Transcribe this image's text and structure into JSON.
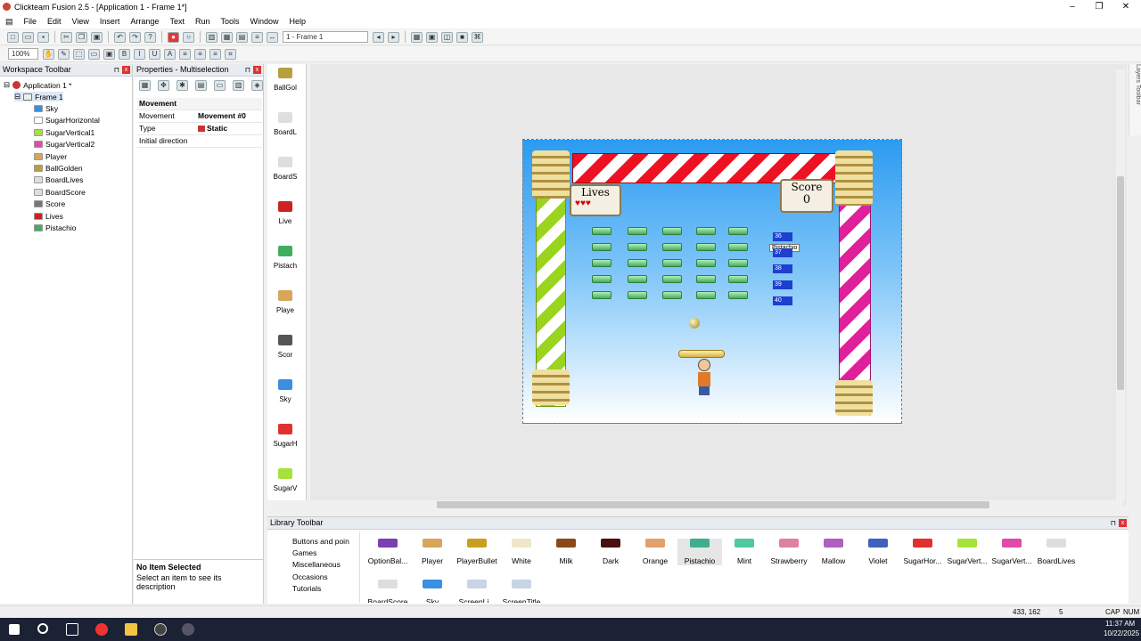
{
  "window": {
    "title": "Clickteam Fusion 2.5 - [Application 1 - Frame 1*]"
  },
  "menu": [
    "File",
    "Edit",
    "View",
    "Insert",
    "Arrange",
    "Text",
    "Run",
    "Tools",
    "Window",
    "Help"
  ],
  "toolbar": {
    "frame_combo": "1 - Frame 1",
    "zoom": "100%"
  },
  "workspace": {
    "title": "Workspace Toolbar",
    "app": "Application 1 *",
    "frame": "Frame 1",
    "objects": [
      {
        "label": "Sky",
        "icon": "sky-icon",
        "color": "#3b8fe0"
      },
      {
        "label": "SugarHorizontal",
        "icon": "sugar-horizontal-icon",
        "color": "#ffffff"
      },
      {
        "label": "SugarVertical1",
        "icon": "sugar-vertical1-icon",
        "color": "#a6e23a"
      },
      {
        "label": "SugarVertical2",
        "icon": "sugar-vertical2-icon",
        "color": "#e04aa8"
      },
      {
        "label": "Player",
        "icon": "player-icon",
        "color": "#d9a55a"
      },
      {
        "label": "BallGolden",
        "icon": "ball-golden-icon",
        "color": "#b8a040"
      },
      {
        "label": "BoardLives",
        "icon": "board-lives-icon",
        "color": "#dedede"
      },
      {
        "label": "BoardScore",
        "icon": "board-score-icon",
        "color": "#dedede"
      },
      {
        "label": "Score",
        "icon": "score-icon",
        "color": "#777777"
      },
      {
        "label": "Lives",
        "icon": "lives-icon",
        "color": "#cc2222"
      },
      {
        "label": "Pistachio",
        "icon": "pistachio-icon",
        "color": "#3fae5f"
      }
    ]
  },
  "properties": {
    "title": "Properties - Multiselection",
    "section": "Movement",
    "rows": [
      {
        "key": "Movement",
        "value": "Movement #0"
      },
      {
        "key": "Type",
        "value": "Static"
      },
      {
        "key": "Initial direction",
        "value": ""
      }
    ],
    "footer_title": "No Item Selected",
    "footer_text": "Select an item to see its description"
  },
  "objectbar": [
    "BallGol",
    "BoardL",
    "BoardS",
    "Live",
    "Pistach",
    "Playe",
    "Scor",
    "Sky",
    "SugarH",
    "SugarV"
  ],
  "frame": {
    "lives_label": "Lives",
    "lives_hearts": "♥♥♥",
    "score_label": "Score",
    "score_value": "0",
    "tooltip": "Pistachio",
    "selected_numbers": [
      "36",
      "37",
      "38",
      "39",
      "40"
    ]
  },
  "library": {
    "title": "Library Toolbar",
    "categories": [
      "Buttons and poin",
      "Games",
      "Miscellaneous",
      "Occasions",
      "Tutorials"
    ],
    "items": [
      {
        "label": "OptionBal...",
        "color": "#7a3fb0"
      },
      {
        "label": "Player",
        "color": "#d9a55a"
      },
      {
        "label": "PlayerBullet",
        "color": "#c8a020"
      },
      {
        "label": "White",
        "color": "#f0e6c8"
      },
      {
        "label": "Milk",
        "color": "#8a4a1a"
      },
      {
        "label": "Dark",
        "color": "#4a1010"
      },
      {
        "label": "Orange",
        "color": "#e0a070"
      },
      {
        "label": "Pistachio",
        "color": "#3fae8f"
      },
      {
        "label": "Mint",
        "color": "#50c8a0"
      },
      {
        "label": "Strawberry",
        "color": "#e080a0"
      },
      {
        "label": "Mallow",
        "color": "#b060c0"
      },
      {
        "label": "Violet",
        "color": "#4060c0"
      },
      {
        "label": "SugarHor...",
        "color": "#e03030"
      },
      {
        "label": "SugarVert...",
        "color": "#a6e23a"
      },
      {
        "label": "SugarVert...",
        "color": "#e04aa8"
      },
      {
        "label": "BoardLives",
        "color": "#dedede"
      }
    ],
    "row2": [
      "BoardScore",
      "Sky",
      "ScreenLi...",
      "ScreenTitle"
    ]
  },
  "status": {
    "coords": "433, 162",
    "count": "5",
    "caps": "CAP",
    "num": "NUM"
  },
  "clock": {
    "time": "11:37 AM",
    "date": "10/22/2025"
  }
}
